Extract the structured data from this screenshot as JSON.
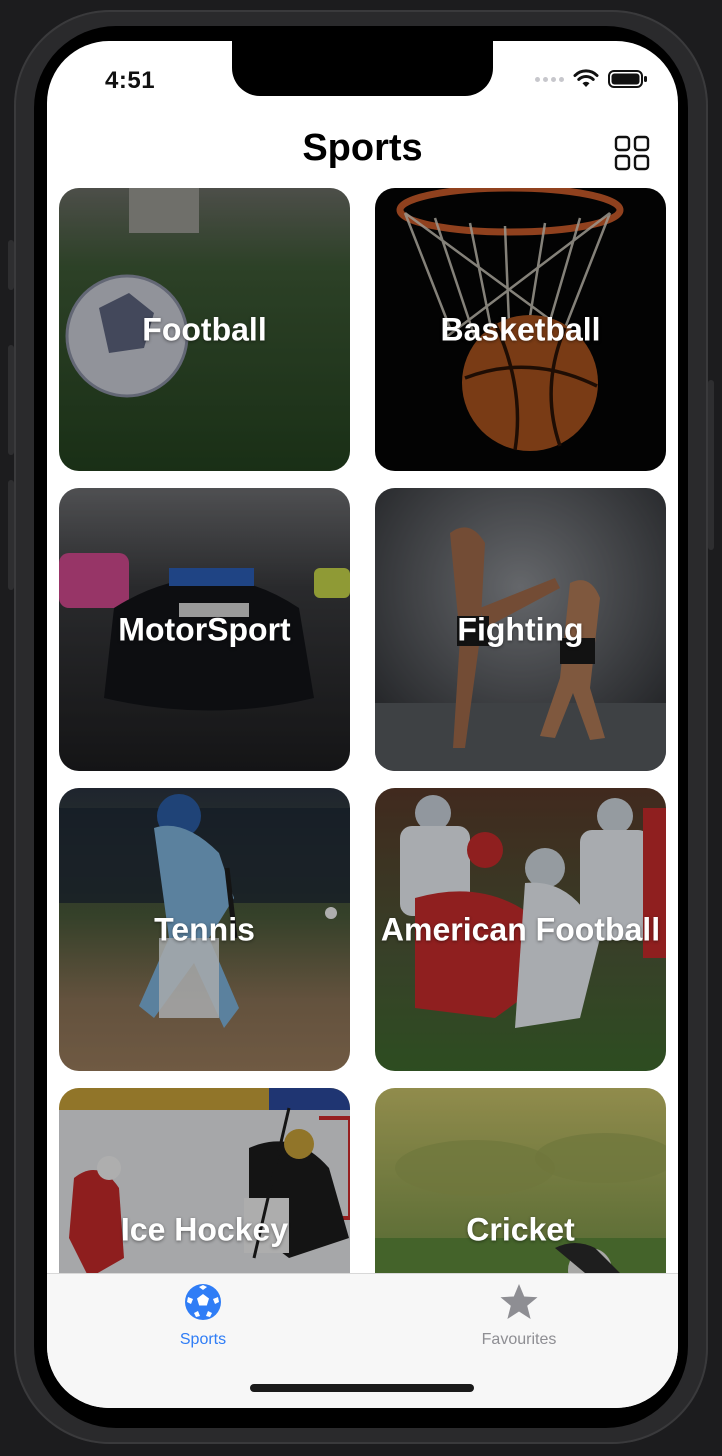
{
  "status": {
    "time": "4:51"
  },
  "nav": {
    "title": "Sports"
  },
  "cards": [
    {
      "label": "Football"
    },
    {
      "label": "Basketball"
    },
    {
      "label": "MotorSport"
    },
    {
      "label": "Fighting"
    },
    {
      "label": "Tennis"
    },
    {
      "label": "American Football"
    },
    {
      "label": "Ice Hockey"
    },
    {
      "label": "Cricket"
    }
  ],
  "tabbar": {
    "items": [
      {
        "label": "Sports",
        "icon": "soccer-ball-icon",
        "selected": true,
        "color": "#2f7df6"
      },
      {
        "label": "Favourites",
        "icon": "star-icon",
        "selected": false,
        "color": "#8e8e93"
      }
    ]
  },
  "icons": {
    "view_toggle": "grid-icon",
    "wifi": "wifi-icon",
    "battery": "battery-icon",
    "cellular": "cellular-dots-icon"
  }
}
